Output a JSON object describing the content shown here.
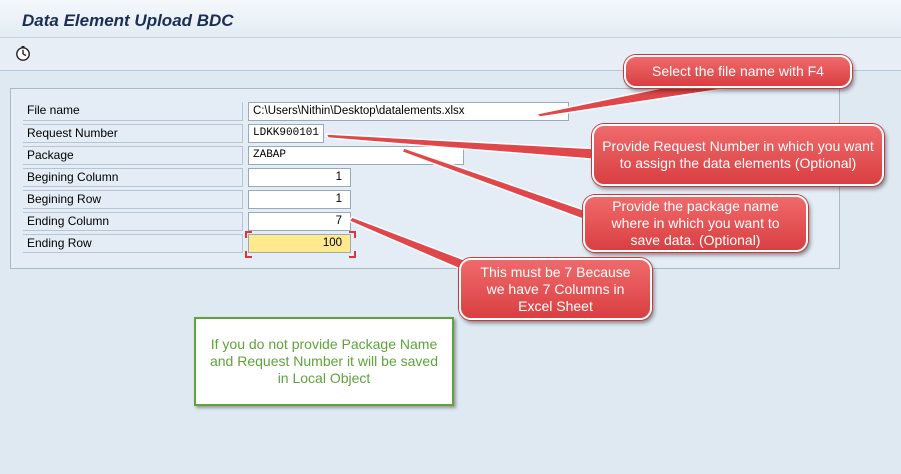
{
  "title": "Data Element Upload BDC",
  "toolbar": {
    "execute_icon": "execute-clock-icon"
  },
  "fields": [
    {
      "label": "File name",
      "value": "C:\\Users\\Nithin\\Desktop\\datalements.xlsx"
    },
    {
      "label": "Request Number",
      "value": "LDKK900101"
    },
    {
      "label": "Package",
      "value": "ZABAP"
    },
    {
      "label": "Begining Column",
      "value": "1"
    },
    {
      "label": "Begining Row",
      "value": "1"
    },
    {
      "label": "Ending Column",
      "value": "7"
    },
    {
      "label": "Ending Row",
      "value": "100"
    }
  ],
  "callouts": {
    "file": "Select the file name with F4",
    "request": "Provide Request Number in which you want to assign the data elements (Optional)",
    "package": "Provide the package name where in which you want to save data. (Optional)",
    "column": "This must be 7 Because we have 7 Columns in Excel Sheet"
  },
  "note": "If you do not provide Package Name and Request Number it will be saved in Local Object",
  "colors": {
    "callout": "#e0474a",
    "note_border": "#5fa33a",
    "active_field": "#ffe98f"
  }
}
